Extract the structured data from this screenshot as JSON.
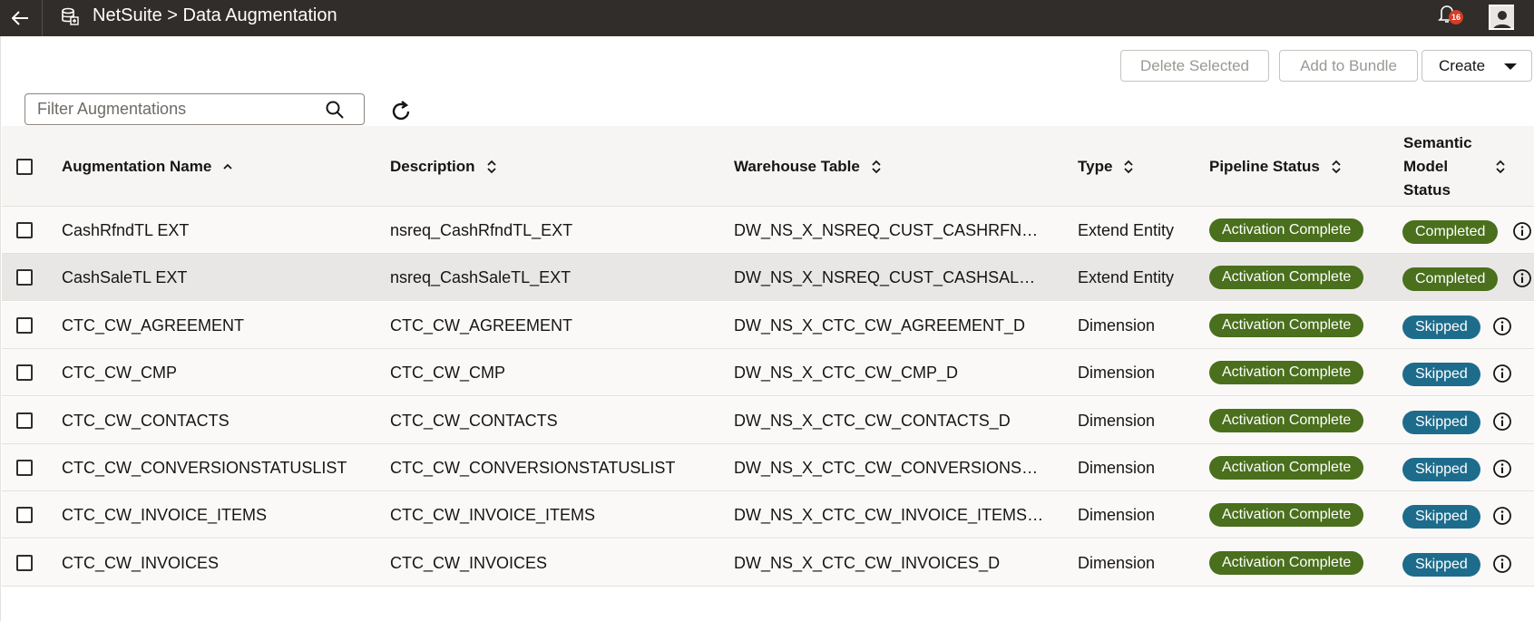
{
  "header": {
    "title": "NetSuite > Data Augmentation",
    "notification_count": "16"
  },
  "toolbar": {
    "delete_label": "Delete Selected",
    "bundle_label": "Add to Bundle",
    "create_label": "Create"
  },
  "filter": {
    "placeholder": "Filter Augmentations",
    "value": ""
  },
  "table": {
    "columns": [
      {
        "label": "Augmentation Name"
      },
      {
        "label": "Description"
      },
      {
        "label": "Warehouse Table"
      },
      {
        "label": "Type"
      },
      {
        "label": "Pipeline Status"
      },
      {
        "label": "Semantic Model Status"
      }
    ],
    "rows": [
      {
        "name": "CashRfndTL EXT",
        "description": "nsreq_CashRfndTL_EXT",
        "warehouse": "DW_NS_X_NSREQ_CUST_CASHRFNDTL_EXT",
        "type": "Extend Entity",
        "pipeline": "Activation Complete",
        "semantic": "Completed"
      },
      {
        "name": "CashSaleTL EXT",
        "description": "nsreq_CashSaleTL_EXT",
        "warehouse": "DW_NS_X_NSREQ_CUST_CASHSALETL_EXT",
        "type": "Extend Entity",
        "pipeline": "Activation Complete",
        "semantic": "Completed"
      },
      {
        "name": "CTC_CW_AGREEMENT",
        "description": "CTC_CW_AGREEMENT",
        "warehouse": "DW_NS_X_CTC_CW_AGREEMENT_D",
        "type": "Dimension",
        "pipeline": "Activation Complete",
        "semantic": "Skipped"
      },
      {
        "name": "CTC_CW_CMP",
        "description": "CTC_CW_CMP",
        "warehouse": "DW_NS_X_CTC_CW_CMP_D",
        "type": "Dimension",
        "pipeline": "Activation Complete",
        "semantic": "Skipped"
      },
      {
        "name": "CTC_CW_CONTACTS",
        "description": "CTC_CW_CONTACTS",
        "warehouse": "DW_NS_X_CTC_CW_CONTACTS_D",
        "type": "Dimension",
        "pipeline": "Activation Complete",
        "semantic": "Skipped"
      },
      {
        "name": "CTC_CW_CONVERSIONSTATUSLIST",
        "description": "CTC_CW_CONVERSIONSTATUSLIST",
        "warehouse": "DW_NS_X_CTC_CW_CONVERSIONSTATUSLIST_D",
        "type": "Dimension",
        "pipeline": "Activation Complete",
        "semantic": "Skipped"
      },
      {
        "name": "CTC_CW_INVOICE_ITEMS",
        "description": "CTC_CW_INVOICE_ITEMS",
        "warehouse": "DW_NS_X_CTC_CW_INVOICE_ITEMS_D",
        "type": "Dimension",
        "pipeline": "Activation Complete",
        "semantic": "Skipped"
      },
      {
        "name": "CTC_CW_INVOICES",
        "description": "CTC_CW_INVOICES",
        "warehouse": "DW_NS_X_CTC_CW_INVOICES_D",
        "type": "Dimension",
        "pipeline": "Activation Complete",
        "semantic": "Skipped"
      }
    ]
  },
  "colors": {
    "topbar": "#312d2a",
    "pipeline_complete": "#4a6f1d",
    "semantic_completed": "#4a6f1d",
    "semantic_skipped": "#1e6c8c",
    "badge": "#d63b25"
  }
}
